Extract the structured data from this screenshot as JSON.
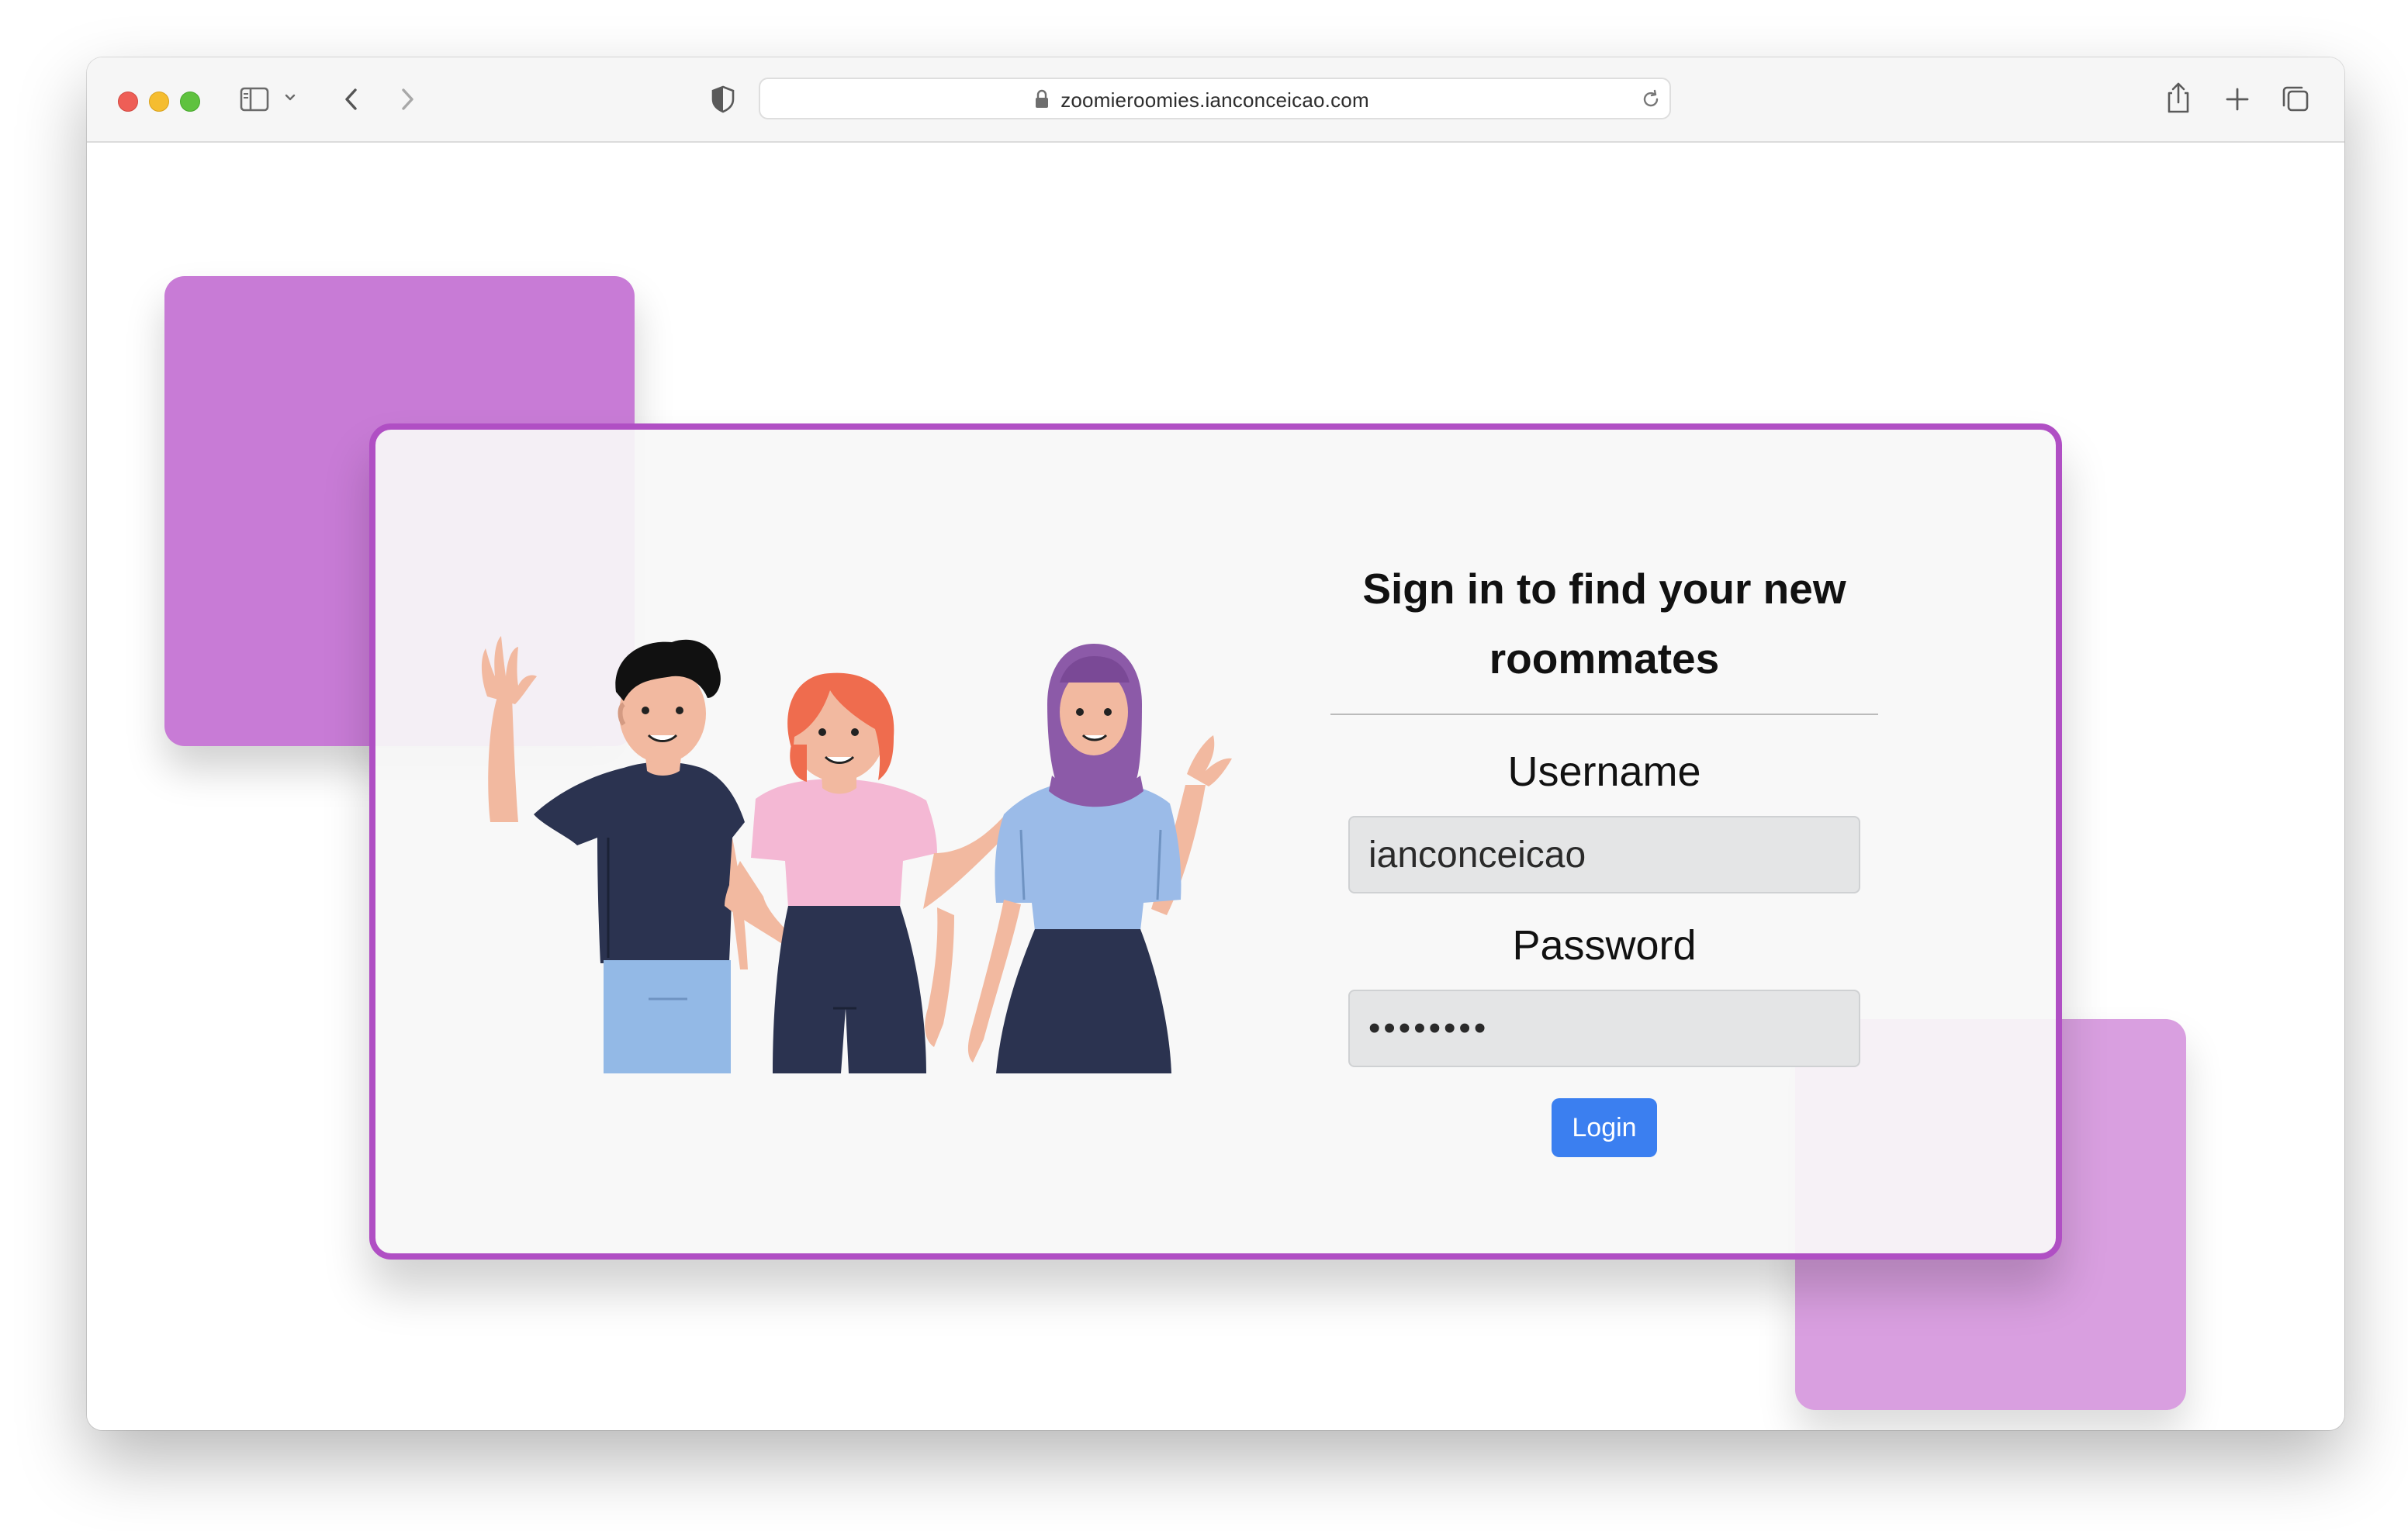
{
  "browser": {
    "url": "zoomieroomies.ianconceicao.com",
    "icons": [
      "close-window-icon",
      "minimize-window-icon",
      "zoom-window-icon",
      "sidebar-icon",
      "chevron-down-icon",
      "back-icon",
      "forward-icon",
      "privacy-shield-icon",
      "lock-icon",
      "reload-icon",
      "share-icon",
      "new-tab-icon",
      "tab-overview-icon"
    ]
  },
  "login": {
    "title": "Sign in to find your new roommates",
    "username_label": "Username",
    "username_value": "ianconceicao",
    "password_label": "Password",
    "password_value": "••••••••",
    "button_label": "Login"
  },
  "illustration": {
    "subject": "people-waving-illustration"
  },
  "colors": {
    "card_border": "#b04fc4",
    "deco_top_left": "#c87bd6",
    "deco_bottom_right": "#d99fe0",
    "login_button": "#3b7ff0"
  }
}
